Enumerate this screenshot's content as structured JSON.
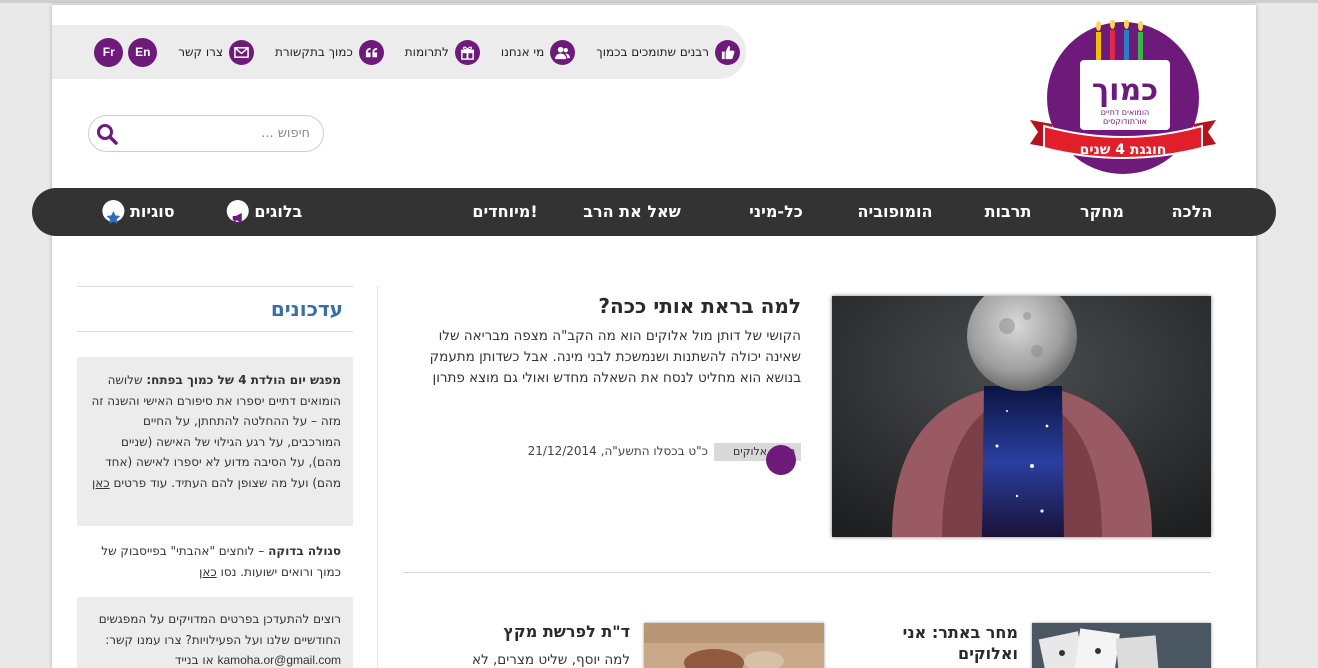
{
  "logo": {
    "brand": "כמוך",
    "tagline_line1": "הומואים דתיים",
    "tagline_line2": "אורתודוקסים",
    "ribbon": "חוגגת 4 שנים"
  },
  "top_links": [
    {
      "label": "רבנים שתומכים בכמוך",
      "icon": "thumbs-up-icon"
    },
    {
      "label": "מי אנחנו",
      "icon": "users-icon"
    },
    {
      "label": "לתרומות",
      "icon": "gift-icon"
    },
    {
      "label": "כמוך בתקשורת",
      "icon": "quote-icon"
    },
    {
      "label": "צרו קשר",
      "icon": "envelope-icon"
    }
  ],
  "languages": [
    "En",
    "Fr"
  ],
  "search": {
    "placeholder": "חיפוש ..."
  },
  "nav": [
    {
      "label": "הלכה"
    },
    {
      "label": "מחקר"
    },
    {
      "label": "תרבות"
    },
    {
      "label": "הומופוביה"
    },
    {
      "label": "כל-מיני"
    },
    {
      "label": "שאל את הרב"
    },
    {
      "label": "מיוחדים!"
    },
    {
      "label": "בלוגים",
      "icon": "megaphone-icon"
    },
    {
      "label": "סוגיות",
      "icon": "star-icon"
    }
  ],
  "featured": {
    "title": "למה בראת אותי ככה?",
    "excerpt": "הקושי של דותן מול אלוקים הוא מה הקב\"ה מצפה מבריאה שלו שאינה יכולה להשתנות ושנמשכת לבני מינה. אבל כשדותן מתעמק בנושא הוא מחליט לנסח את השאלה מחדש ואולי גם מוצא פתרון",
    "category": "סוגית אלוקים",
    "date": "כ\"ט בכסלו התשע\"ה, 21/12/2014"
  },
  "cards": [
    {
      "title": "מחר באתר: אני ואלוקים"
    },
    {
      "title": "ד\"ת לפרשת מקץ",
      "excerpt": "למה יוסף, שליט מצרים, לא"
    }
  ],
  "sidebar": {
    "title": "עדכונים",
    "item1": {
      "bold": "מפגש יום הולדת 4 של כמוך בפתח:",
      "text": " שלושה הומואים דתיים יספרו את סיפורם האישי והשנה זה מזה – על ההחלטה להתחתן, על החיים המורכבים, על רגע הגילוי של האישה (שניים מהם), על הסיבה מדוע לא יספרו לאישה (אחד מהם) ועל מה שצופן להם העתיד. עוד פרטים ",
      "link": "כאן"
    },
    "item2": {
      "bold": "סגולה בדוקה",
      "text": " – לוחצים \"אהבתי\" בפייסבוק של כמוך ורואים ישועות. נסו ",
      "link": "כאן"
    },
    "item3": {
      "text": "רוצים להתעדכן בפרטים המדויקים על המפגשים החודשיים שלנו ועל הפעילויות? צרו עמנו קשר: ",
      "email": "kamoha.or@gmail.com",
      "tail": " או בנייד"
    }
  }
}
